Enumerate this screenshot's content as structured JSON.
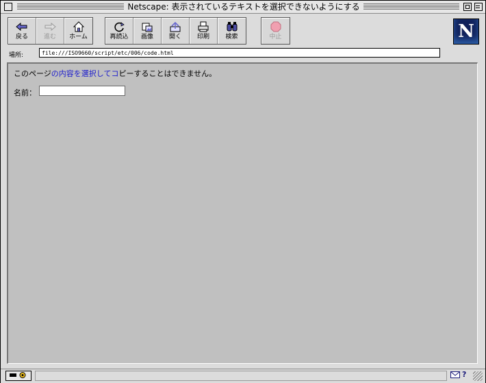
{
  "window": {
    "title": "Netscape: 表示されているテキストを選択できないようにする"
  },
  "toolbar": {
    "buttons": [
      {
        "label": "戻る",
        "icon": "back-arrow-icon"
      },
      {
        "label": "進む",
        "icon": "forward-arrow-icon"
      },
      {
        "label": "ホーム",
        "icon": "home-icon"
      },
      {
        "label": "再読込",
        "icon": "reload-icon"
      },
      {
        "label": "画像",
        "icon": "images-icon"
      },
      {
        "label": "開く",
        "icon": "open-icon"
      },
      {
        "label": "印刷",
        "icon": "print-icon"
      },
      {
        "label": "検索",
        "icon": "find-binoculars-icon"
      },
      {
        "label": "中止",
        "icon": "stop-icon"
      }
    ],
    "logo_letter": "N"
  },
  "location": {
    "label": "場所:",
    "url": "file:///ISO9660/script/etc/006/code.html"
  },
  "page": {
    "message_part1": "このページ",
    "message_link": "の内容を選択してコ",
    "message_part2": "ピーすることはできません。",
    "name_label": "名前：",
    "name_value": ""
  },
  "statusbar": {
    "security_icon": "lock-key-icon",
    "help_text": "?"
  }
}
